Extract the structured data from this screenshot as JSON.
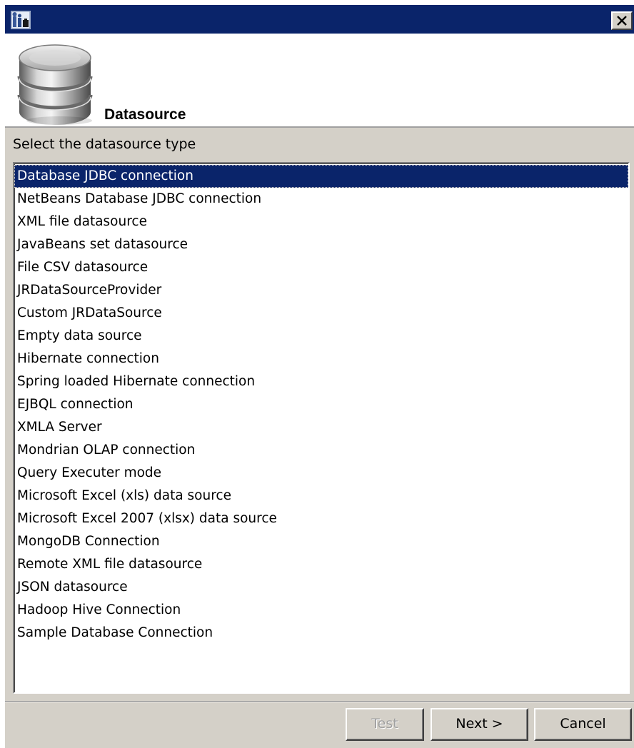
{
  "window": {
    "title": "",
    "close_label": "close"
  },
  "header": {
    "title": "Datasource",
    "icon": "database-icon"
  },
  "prompt": "Select the datasource type",
  "datasource_types": [
    "Database JDBC connection",
    "NetBeans Database JDBC connection",
    "XML file datasource",
    "JavaBeans set datasource",
    "File CSV datasource",
    "JRDataSourceProvider",
    "Custom JRDataSource",
    "Empty data source",
    "Hibernate connection",
    "Spring loaded Hibernate connection",
    "EJBQL connection",
    "XMLA Server",
    "Mondrian OLAP connection",
    "Query Executer mode",
    "Microsoft Excel (xls) data source",
    "Microsoft Excel 2007 (xlsx) data source",
    "MongoDB Connection",
    "Remote XML file datasource",
    "JSON datasource",
    "Hadoop Hive Connection",
    "Sample Database Connection"
  ],
  "selected_index": 0,
  "buttons": {
    "test": "Test",
    "next": "Next >",
    "cancel": "Cancel"
  },
  "colors": {
    "titlebar": "#0a246a",
    "selection": "#0a246a",
    "dialog_bg": "#d4d0c8"
  }
}
